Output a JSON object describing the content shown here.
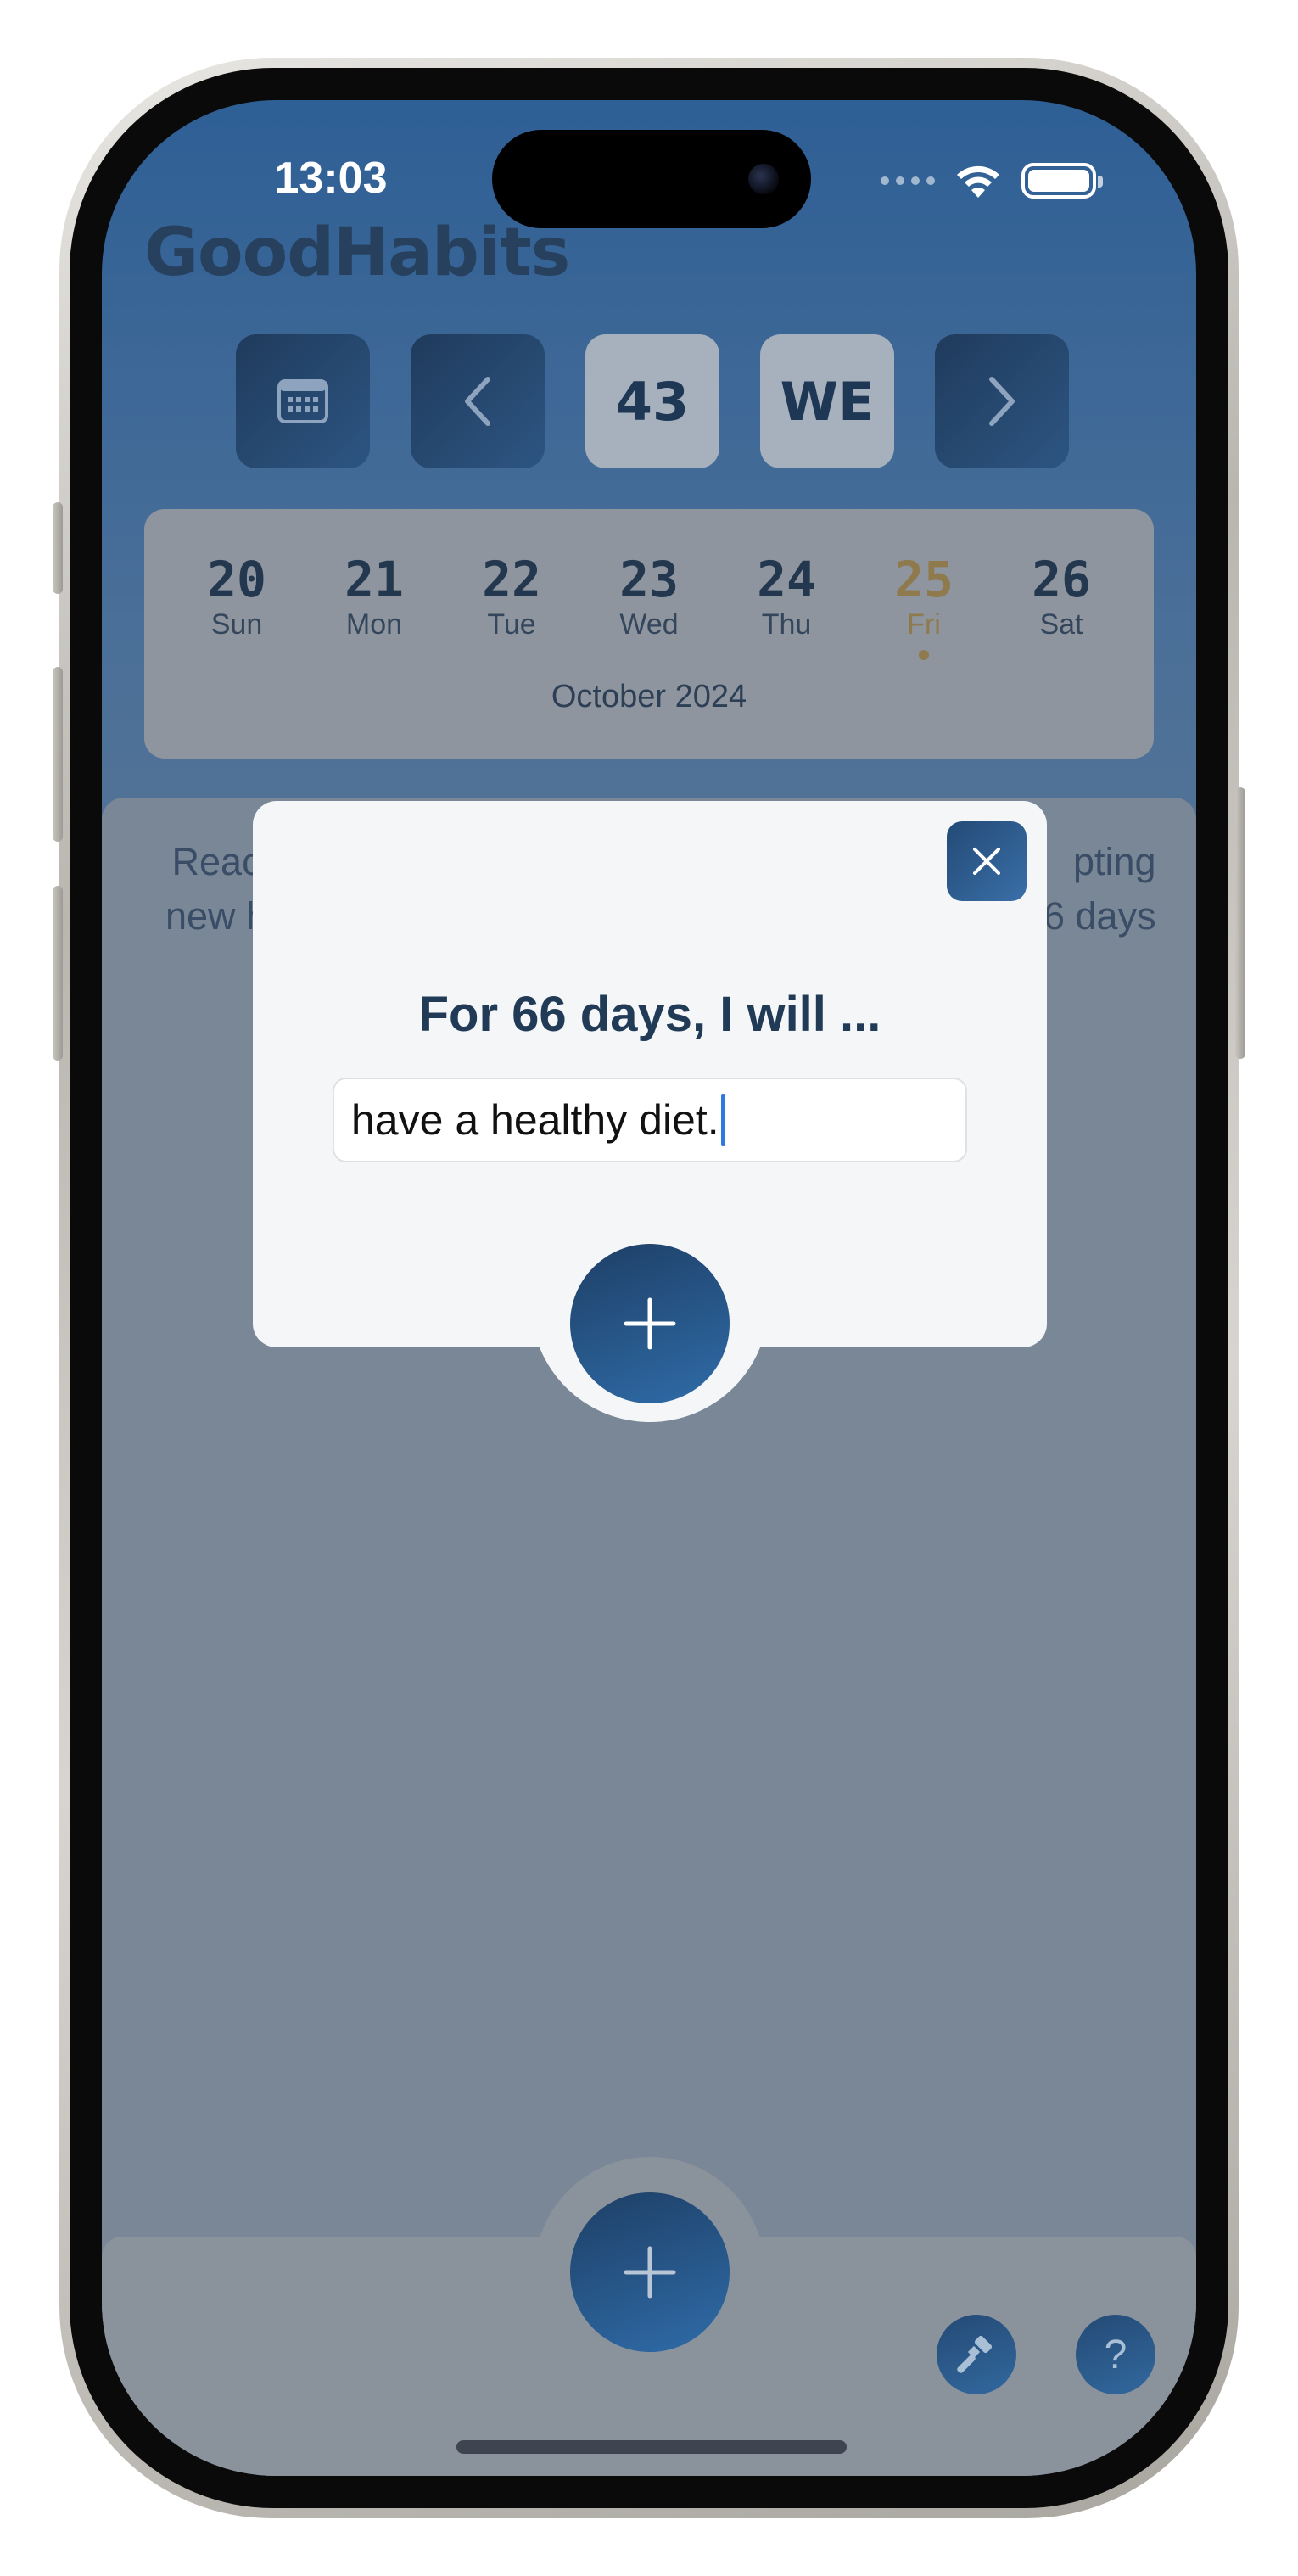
{
  "status_bar": {
    "time": "13:03"
  },
  "app": {
    "title": "GoodHabits"
  },
  "toolbar": {
    "calendar_icon": "calendar-icon",
    "prev_icon": "chevron-left-icon",
    "week_number": "43",
    "weekday_abbrev": "WE",
    "next_icon": "chevron-right-icon"
  },
  "week": {
    "days": [
      {
        "num": "20",
        "name": "Sun"
      },
      {
        "num": "21",
        "name": "Mon"
      },
      {
        "num": "22",
        "name": "Tue"
      },
      {
        "num": "23",
        "name": "Wed"
      },
      {
        "num": "24",
        "name": "Thu"
      },
      {
        "num": "25",
        "name": "Fri",
        "today": true
      },
      {
        "num": "26",
        "name": "Sat"
      }
    ],
    "month": "October 2024",
    "today_color": "#8e7a4c"
  },
  "background_text": {
    "left_line1": "Reac",
    "left_line2": "new h",
    "right_line1": "pting",
    "right_line2": "6 days"
  },
  "modal": {
    "heading": "For 66 days, I will ...",
    "input_value": "have a healthy diet.",
    "close_icon": "close-icon",
    "add_icon": "plus-icon"
  },
  "bottom": {
    "add_icon": "plus-icon",
    "tools_icon": "hammer-icon",
    "help_label": "?"
  },
  "colors": {
    "accent_dark": "#1e3f66",
    "accent": "#2f6ca8",
    "title": "#213b57"
  }
}
